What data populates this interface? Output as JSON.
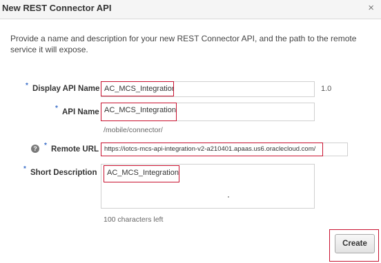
{
  "dialog": {
    "title": "New REST Connector API",
    "close_glyph": "×",
    "close_icon": "close-icon",
    "intro": "Provide a name and description for your new REST Connector API, and the path to the remote service it will expose."
  },
  "form": {
    "required_marker": "*",
    "display_api_name": {
      "label": "Display API Name",
      "value": "AC_MCS_Integration",
      "version": "1.0"
    },
    "api_name": {
      "label": "API Name",
      "value": "AC_MCS_Integration",
      "path_hint": "/mobile/connector/"
    },
    "remote_url": {
      "label": "Remote URL",
      "help_glyph": "?",
      "help_icon": "help-icon",
      "value": "https://iotcs-mcs-api-integration-v2-a210401.apaas.us6.oraclecloud.com/"
    },
    "short_description": {
      "label": "Short Description",
      "value": "AC_MCS_Integration",
      "remaining": "100 characters left"
    }
  },
  "footer": {
    "create_label": "Create"
  },
  "colors": {
    "highlight": "#c8102e",
    "required": "#3a6ec8"
  }
}
